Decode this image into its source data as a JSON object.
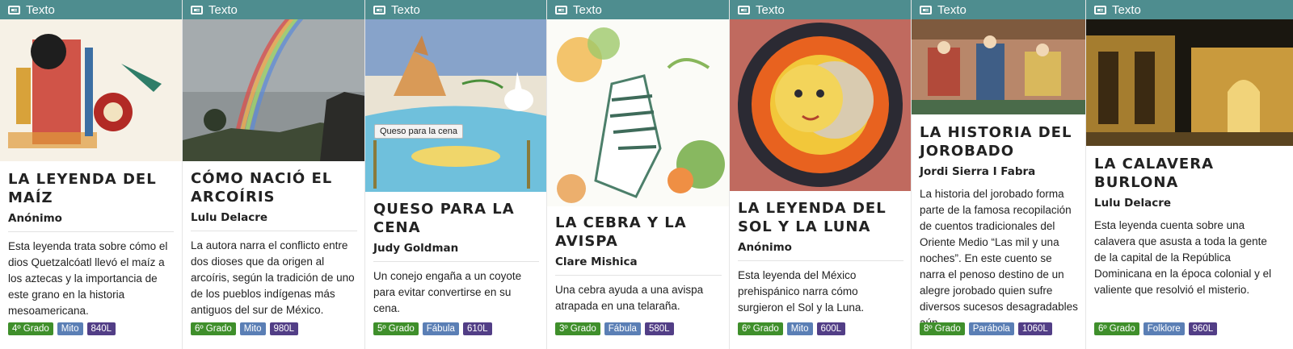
{
  "colors": {
    "header_bg": "#4e8d8f",
    "grade_tag": "#3f8f2b",
    "genre_tag": "#5b7fb5",
    "lexile_tag": "#523e86"
  },
  "cards": [
    {
      "type_label": "Texto",
      "type_icon": "book-icon",
      "image_subject": "aztec-deity-illustration",
      "title": "La leyenda del maíz",
      "author": "Anónimo",
      "description": "Esta leyenda trata sobre cómo el dios Quetzalcóatl llevó el maíz a los aztecas y la importancia de este grano en la historia mesoamericana.",
      "grade": "4º Grado",
      "genre": "Mito",
      "lexile": "840L"
    },
    {
      "type_label": "Texto",
      "type_icon": "book-icon",
      "image_subject": "rainbow-landscape-photo",
      "title": "Cómo nació el arcoíris",
      "author": "Lulu Delacre",
      "description": "La autora narra el conflicto entre dos dioses que da origen al arcoíris, según la tradición de uno de los pueblos indígenas más antiguos del sur de México.",
      "grade": "6º Grado",
      "genre": "Mito",
      "lexile": "980L"
    },
    {
      "type_label": "Texto",
      "type_icon": "book-icon",
      "image_subject": "coyote-and-rabbit-illustration",
      "image_caption": "Queso para la cena",
      "title": "Queso para la cena",
      "author": "Judy Goldman",
      "description": "Un conejo engaña a un coyote para evitar convertirse en su cena.",
      "grade": "5º Grado",
      "genre": "Fábula",
      "lexile": "610L"
    },
    {
      "type_label": "Texto",
      "type_icon": "book-icon",
      "image_subject": "zebra-illustration",
      "title": "La cebra y la avispa",
      "author": "Clare Mishica",
      "description": "Una cebra ayuda a una avispa atrapada en una telaraña.",
      "grade": "3º Grado",
      "genre": "Fábula",
      "lexile": "580L"
    },
    {
      "type_label": "Texto",
      "type_icon": "book-icon",
      "image_subject": "sun-and-moon-artwork",
      "title": "La leyenda del sol y la luna",
      "author": "Anónimo",
      "description": "Esta leyenda del México prehispánico narra cómo surgieron el Sol y la Luna.",
      "grade": "6º Grado",
      "genre": "Mito",
      "lexile": "600L"
    },
    {
      "type_label": "Texto",
      "type_icon": "book-icon",
      "image_subject": "persian-miniature-painting",
      "title": "La historia del jorobado",
      "author": "Jordi Sierra I Fabra",
      "description": "La historia del jorobado forma parte de la famosa recopilación de cuentos tradicionales del Oriente Medio “Las mil y una noches”. En este cuento se narra el penoso destino de un alegre jorobado quien sufre diversos sucesos desagradables aún…",
      "grade": "8º Grado",
      "genre": "Parábola",
      "lexile": "1060L"
    },
    {
      "type_label": "Texto",
      "type_icon": "book-icon",
      "image_subject": "colonial-building-night-photo",
      "title": "La calavera burlona",
      "author": "Lulu Delacre",
      "description": "Esta leyenda cuenta sobre una calavera que asusta a toda la gente de la capital de la República Dominicana en la época colonial y el valiente que resolvió el misterio.",
      "grade": "6º Grado",
      "genre": "Folklore",
      "lexile": "960L"
    }
  ]
}
